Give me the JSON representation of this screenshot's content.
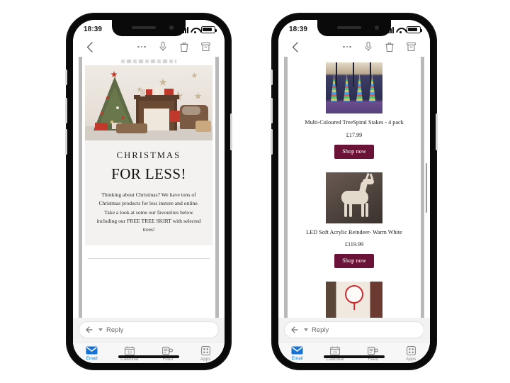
{
  "phones": [
    {
      "id": "left",
      "status": {
        "time": "18:39",
        "wifi": "wifi-icon",
        "battery": "battery-icon",
        "signal": "signal-icon"
      },
      "toolbar": {
        "back": "back-chevron-icon",
        "more": "more-options-icon",
        "mic": "microphone-icon",
        "delete": "trash-icon",
        "archive": "archive-icon"
      },
      "email": {
        "hero_alt": "christmas-tree-living-room-photo",
        "heading": "CHRISTMAS",
        "subheading": "FOR LESS!",
        "body": "Thinking about Christmas? We have tons of Christmas products for less instore and online. Take  a look at some our favourites below including our FREE TREE SKIRT with selected trees!"
      },
      "reply": {
        "placeholder": "Reply",
        "icon": "reply-arrow-icon",
        "chevron": "chevron-down-icon"
      },
      "tabs": [
        {
          "label": "Email",
          "icon": "envelope-icon",
          "active": true
        },
        {
          "label": "Calendar",
          "icon": "calendar-icon",
          "active": false
        },
        {
          "label": "Feed",
          "icon": "feed-icon",
          "active": false
        },
        {
          "label": "Apps",
          "icon": "apps-grid-icon",
          "active": false
        }
      ]
    },
    {
      "id": "right",
      "status": {
        "time": "18:39",
        "wifi": "wifi-icon",
        "battery": "battery-icon",
        "signal": "signal-icon"
      },
      "toolbar": {
        "back": "back-chevron-icon",
        "more": "more-options-icon",
        "mic": "microphone-icon",
        "delete": "trash-icon",
        "archive": "archive-icon"
      },
      "products": [
        {
          "image_alt": "multi-coloured-tree-spiral-stakes-photo",
          "title": "Multi-Coloured TreeSpiral Stakes - 4 pack",
          "price": "£17.99",
          "cta": "Shop now"
        },
        {
          "image_alt": "led-soft-acrylic-reindeer-photo",
          "title": "LED Soft Acrylic Reindeer- Warm White",
          "price": "£119.99",
          "cta": "Shop now"
        },
        {
          "image_alt": "santa-stop-here-sign-photo",
          "title": "",
          "price": "",
          "cta": ""
        }
      ],
      "reply": {
        "placeholder": "Reply",
        "icon": "reply-arrow-icon",
        "chevron": "chevron-down-icon"
      },
      "tabs": [
        {
          "label": "Email",
          "icon": "envelope-icon",
          "active": true
        },
        {
          "label": "Calendar",
          "icon": "calendar-icon",
          "active": false
        },
        {
          "label": "Feed",
          "icon": "feed-icon",
          "active": false
        },
        {
          "label": "Apps",
          "icon": "apps-grid-icon",
          "active": false
        }
      ]
    }
  ],
  "colors": {
    "cta_background": "#6b1239",
    "accent_active_tab": "#1673d1",
    "promo_background": "#f3f2f1",
    "page_background": "#ffffff"
  }
}
